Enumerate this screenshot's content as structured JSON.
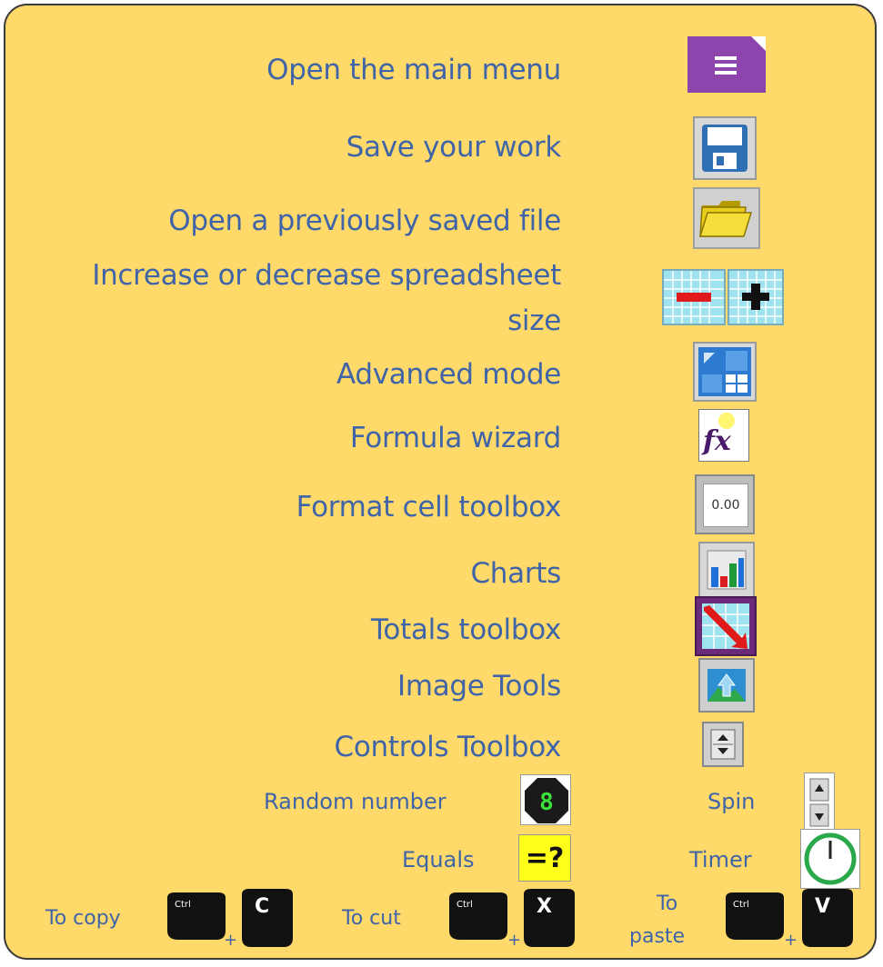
{
  "rows": {
    "main_menu": "Open the main menu",
    "save": "Save your work",
    "open": "Open a previously saved file",
    "resize_line1": "Increase or decrease spreadsheet",
    "resize_line2": "size",
    "advanced": "Advanced mode",
    "formula": "Formula wizard",
    "format": "Format cell toolbox",
    "charts": "Charts",
    "totals": "Totals toolbox",
    "image": "Image Tools",
    "controls": "Controls Toolbox"
  },
  "extras": {
    "random": "Random number",
    "spin": "Spin",
    "equals": "Equals",
    "timer": "Timer"
  },
  "shortcuts": {
    "copy": "To copy",
    "cut": "To cut",
    "paste_line1": "To",
    "paste_line2": "paste",
    "ctrl": "Ctrl",
    "plus": "+",
    "c": "C",
    "x": "X",
    "v": "V"
  },
  "icons": {
    "format_value": "0.00",
    "equals_glyph": "=?",
    "random_digit": "8"
  },
  "colors": {
    "background": "#FFD96A",
    "text": "#3F64A8",
    "menu_purple": "#8E44AD"
  }
}
